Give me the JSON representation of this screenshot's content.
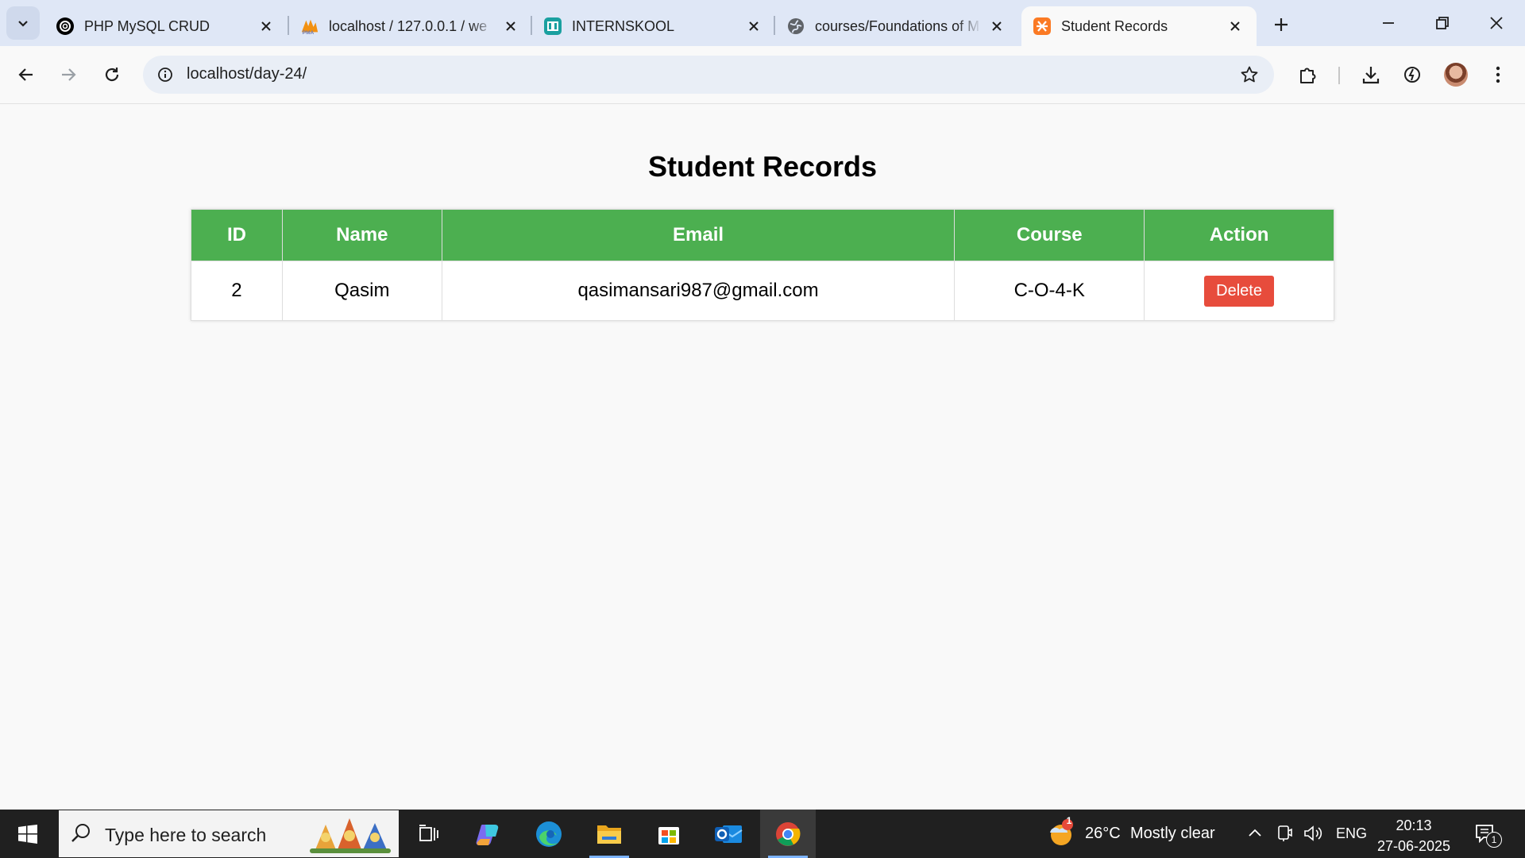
{
  "browser": {
    "tabs": [
      {
        "title": "PHP MySQL CRUD",
        "icon": "openai-icon"
      },
      {
        "title": "localhost / 127.0.0.1 / we",
        "icon": "phpmyadmin-icon"
      },
      {
        "title": "INTERNSKOOL",
        "icon": "internskool-icon"
      },
      {
        "title": "courses/Foundations of M",
        "icon": "globe-icon"
      },
      {
        "title": "Student Records",
        "icon": "xampp-icon"
      }
    ],
    "active_tab": 4,
    "url": "localhost/day-24/"
  },
  "page": {
    "title": "Student Records",
    "table": {
      "headers": {
        "id": "ID",
        "name": "Name",
        "email": "Email",
        "course": "Course",
        "action": "Action"
      },
      "rows": [
        {
          "id": "2",
          "name": "Qasim",
          "email": "qasimansari987@gmail.com",
          "course": "C-O-4-K",
          "action_label": "Delete"
        }
      ]
    },
    "colors": {
      "header_bg": "#4caf50",
      "delete_bg": "#e74c3c"
    }
  },
  "taskbar": {
    "search_placeholder": "Type here to search",
    "weather": {
      "temp": "26°C",
      "condition": "Mostly clear",
      "badge": "1"
    },
    "language": "ENG",
    "time": "20:13",
    "date": "27-06-2025",
    "notification_count": "1"
  }
}
